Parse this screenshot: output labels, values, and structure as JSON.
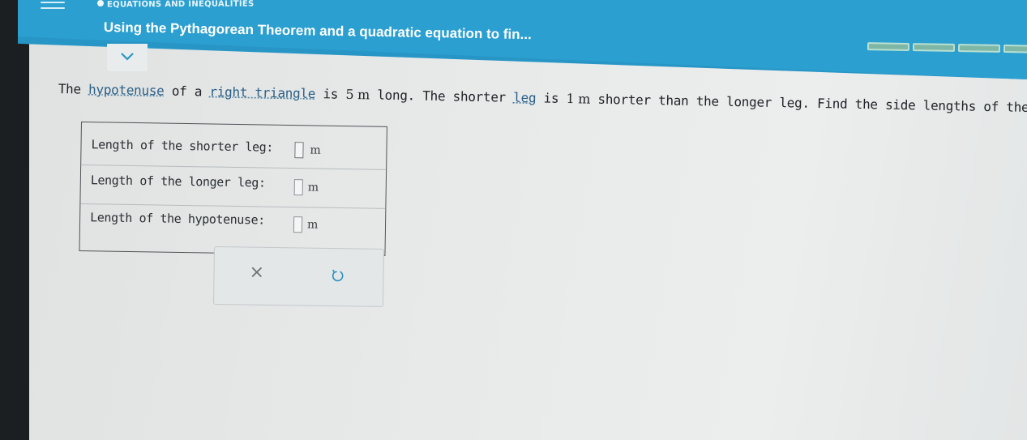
{
  "header": {
    "breadcrumb": "EQUATIONS AND INEQUALITIES",
    "title": "Using the Pythagorean Theorem and a quadratic equation to fin...",
    "progress_segments": 4
  },
  "question": {
    "t1": "The ",
    "link1": "hypotenuse",
    "t2": " of a ",
    "link2": "right triangle",
    "t3": " is ",
    "n1": "5 m",
    "t4": " long. The shorter ",
    "link3": "leg",
    "t5": " is ",
    "n2": "1 m",
    "t6": " shorter than the longer leg. Find the side lengths of the triangle."
  },
  "answers": [
    {
      "label": "Length of the shorter leg:",
      "value": "",
      "unit": "m"
    },
    {
      "label": "Length of the longer leg:",
      "value": "",
      "unit": "m"
    },
    {
      "label": "Length of the hypotenuse:",
      "value": "",
      "unit": "m"
    }
  ],
  "actions": {
    "clear_symbol": "×"
  },
  "colors": {
    "header": "#2796c6",
    "link": "#2b5f86"
  }
}
